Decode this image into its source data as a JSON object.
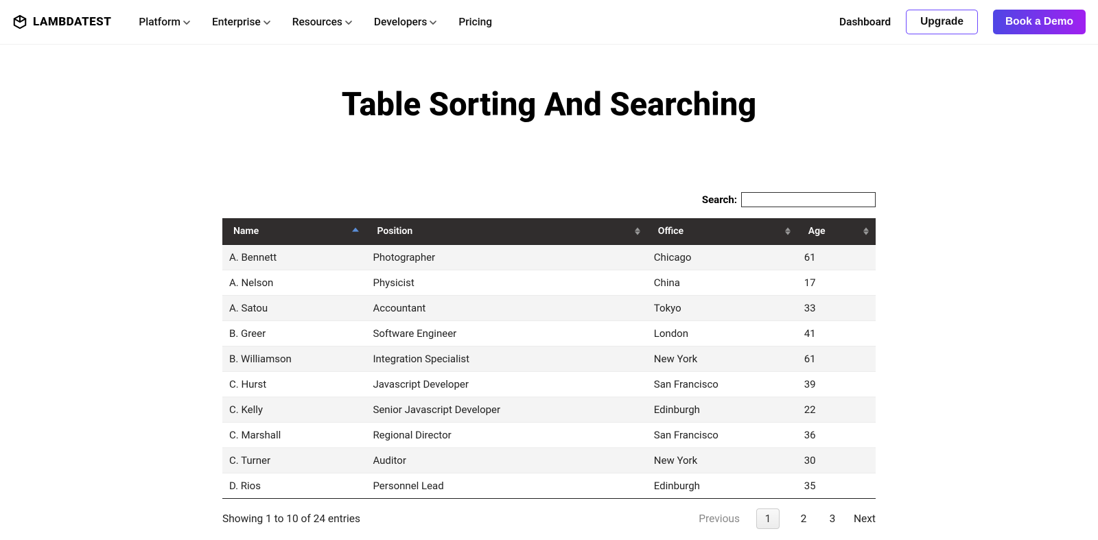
{
  "brand": {
    "name": "LAMBDATEST"
  },
  "nav": {
    "items": [
      {
        "label": "Platform"
      },
      {
        "label": "Enterprise"
      },
      {
        "label": "Resources"
      },
      {
        "label": "Developers"
      },
      {
        "label": "Pricing",
        "no_chevron": true
      }
    ],
    "dashboard": "Dashboard",
    "upgrade": "Upgrade",
    "book_demo": "Book a Demo"
  },
  "page": {
    "title": "Table Sorting And Searching"
  },
  "search": {
    "label": "Search:",
    "value": ""
  },
  "table": {
    "columns": [
      {
        "label": "Name",
        "sort": "asc"
      },
      {
        "label": "Position",
        "sort": "both"
      },
      {
        "label": "Office",
        "sort": "both"
      },
      {
        "label": "Age",
        "sort": "both"
      }
    ],
    "rows": [
      {
        "name": "A. Bennett",
        "position": "Photographer",
        "office": "Chicago",
        "age": "61"
      },
      {
        "name": "A. Nelson",
        "position": "Physicist",
        "office": "China",
        "age": "17"
      },
      {
        "name": "A. Satou",
        "position": "Accountant",
        "office": "Tokyo",
        "age": "33"
      },
      {
        "name": "B. Greer",
        "position": "Software Engineer",
        "office": "London",
        "age": "41"
      },
      {
        "name": "B. Williamson",
        "position": "Integration Specialist",
        "office": "New York",
        "age": "61"
      },
      {
        "name": "C. Hurst",
        "position": "Javascript Developer",
        "office": "San Francisco",
        "age": "39"
      },
      {
        "name": "C. Kelly",
        "position": "Senior Javascript Developer",
        "office": "Edinburgh",
        "age": "22"
      },
      {
        "name": "C. Marshall",
        "position": "Regional Director",
        "office": "San Francisco",
        "age": "36"
      },
      {
        "name": "C. Turner",
        "position": "Auditor",
        "office": "New York",
        "age": "30"
      },
      {
        "name": "D. Rios",
        "position": "Personnel Lead",
        "office": "Edinburgh",
        "age": "35"
      }
    ],
    "col_widths": [
      "22%",
      "43%",
      "23%",
      "12%"
    ]
  },
  "footer": {
    "info": "Showing 1 to 10 of 24 entries",
    "previous": "Previous",
    "next": "Next",
    "pages": [
      "1",
      "2",
      "3"
    ],
    "current_page": "1"
  }
}
